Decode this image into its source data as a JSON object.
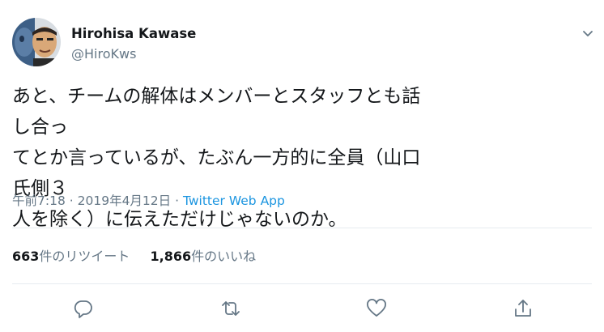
{
  "tweet": {
    "display_name": "Hirohisa Kawase",
    "handle": "@HiroKws",
    "text_lines": [
      "あと、チームの解体はメンバーとスタッフとも話し合っ",
      "てとか言っているが、たぶん一方的に全員（山口氏側３",
      "人を除く）に伝えただけじゃないのか。"
    ],
    "time": "午前7:18",
    "date": "2019年4月12日",
    "separator": "·",
    "source": "Twitter Web App"
  },
  "stats": {
    "retweets_count": "663",
    "retweets_label": "件のリツイート",
    "likes_count": "1,866",
    "likes_label": "件のいいね"
  },
  "icons": {
    "caret": "chevron-down-icon",
    "reply": "reply-icon",
    "retweet": "retweet-icon",
    "like": "heart-icon",
    "share": "share-icon"
  },
  "colors": {
    "text": "#14171a",
    "secondary": "#657786",
    "link": "#1b95e0",
    "divider": "#e6ecf0"
  }
}
